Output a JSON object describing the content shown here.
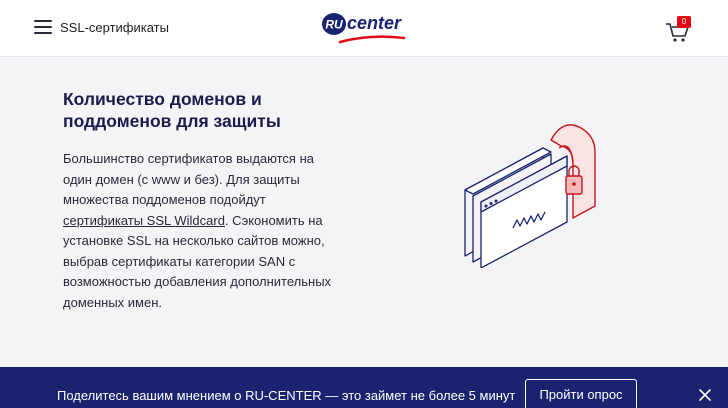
{
  "header": {
    "menu_icon": "hamburger-icon",
    "section_title": "SSL-сертификаты",
    "logo_text": "RU center",
    "cart_icon": "cart-icon",
    "cart_count": "0"
  },
  "main": {
    "heading": "Количество доменов и поддоменов для защиты",
    "paragraph_before_link": "Большинство сертификатов выдаются на один домен (с www и без). Для защиты множества поддоменов подойдут ",
    "link_text": "сертификаты SSL Wildcard",
    "paragraph_after_link": ". Сэкономить на установке SSL на несколько сайтов можно, выбрав сертификаты категории SAN с возможностью добавления дополнительных доменных имен.",
    "illustration": "browser-windows-lock-illustration"
  },
  "banner": {
    "text": "Поделитесь вашим мнением о RU-CENTER — это займет не более 5 минут",
    "button_label": "Пройти опрос",
    "close_icon": "close-icon"
  },
  "colors": {
    "brand_blue": "#1b2370",
    "brand_red": "#e30613",
    "background": "#f4f4f6"
  }
}
